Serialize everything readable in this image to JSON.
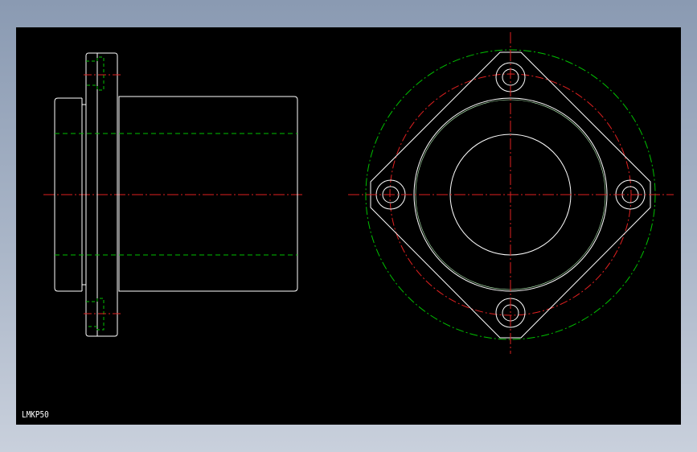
{
  "drawing": {
    "label": "LMKP50"
  },
  "colors": {
    "background": "#000000",
    "outline": "#ffffff",
    "hidden_line": "#00c000",
    "center_line": "#e02020",
    "phantom_line": "#00c000"
  }
}
